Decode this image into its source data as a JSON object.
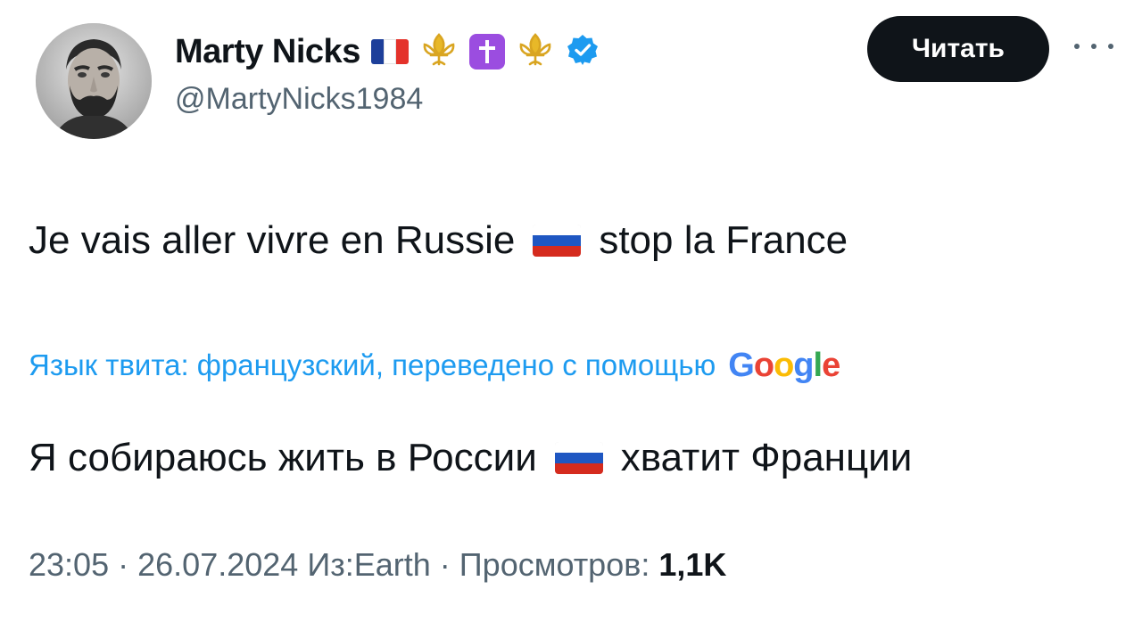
{
  "author": {
    "display_name": "Marty Nicks",
    "handle": "@MartyNicks1984",
    "badges": [
      "flag-france-icon",
      "fleur-de-lis-icon",
      "latin-cross-icon",
      "fleur-de-lis-icon",
      "verified-badge-icon"
    ]
  },
  "actions": {
    "follow_label": "Читать",
    "more_icon": "more-horizontal-icon"
  },
  "tweet": {
    "text_part1": "Je vais aller vivre en Russie",
    "text_part2": "stop la France",
    "flag_icon": "flag-russia-icon"
  },
  "translation": {
    "note": "Язык твита: французский, переведено с помощью",
    "provider_logo_letters": [
      "G",
      "o",
      "o",
      "g",
      "l",
      "e"
    ],
    "text_part1": "Я собираюсь жить в России",
    "text_part2": "хватит Франции"
  },
  "meta": {
    "time": "23:05",
    "date": "26.07.2024",
    "source_prefix": "Из:",
    "source": "Earth",
    "views_label": "Просмотров:",
    "views_count": "1,1K",
    "separator": "·"
  },
  "colors": {
    "text": "#0f1419",
    "secondary": "#536471",
    "link": "#1d9bf0",
    "verified": "#1d9bf0",
    "button_bg": "#0f1419",
    "cross_bg": "#9b4de0",
    "fleur_gold": "#d9a521",
    "google_blue": "#4285f4",
    "google_red": "#ea4335",
    "google_yellow": "#fbbc05",
    "google_green": "#34a853"
  }
}
